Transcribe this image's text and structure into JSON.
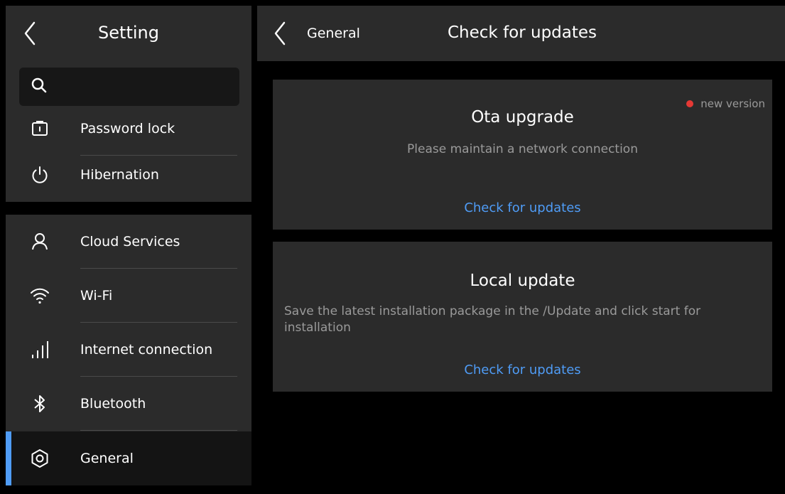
{
  "sidebar": {
    "title": "Setting",
    "search": {
      "placeholder": ""
    },
    "group1": [
      {
        "label": "Password lock",
        "icon": "lock-icon"
      },
      {
        "label": "Hibernation",
        "icon": "power-icon"
      }
    ],
    "group2": [
      {
        "label": "Cloud Services",
        "icon": "user-icon"
      },
      {
        "label": "Wi-Fi",
        "icon": "wifi-icon"
      },
      {
        "label": "Internet connection",
        "icon": "signal-icon"
      },
      {
        "label": "Bluetooth",
        "icon": "bluetooth-icon"
      },
      {
        "label": "General",
        "icon": "gear-icon",
        "active": true
      }
    ]
  },
  "header": {
    "breadcrumb": "General",
    "title": "Check for updates"
  },
  "ota": {
    "title": "Ota upgrade",
    "description": "Please maintain a network connection",
    "badge": "new version",
    "action": "Check for updates"
  },
  "local": {
    "title": "Local update",
    "description": "Save the latest installation package in the /Update and click start for installation",
    "action": "Check for updates"
  },
  "colors": {
    "accent": "#4f9cf6",
    "badge_dot": "#e53935",
    "panel": "#2b2b2b",
    "background": "#000000"
  }
}
